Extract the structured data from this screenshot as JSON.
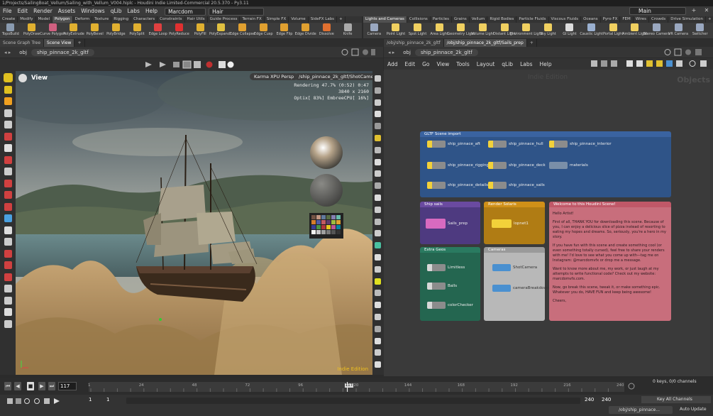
{
  "titlebar": {
    "text": "1/Projects/SailingBoat_Vellum/Sailing_with_Vellum_V004.hiplc - Houdini Indie Limited-Commercial 20.5.370 - Py3.11"
  },
  "menu": [
    "File",
    "Edit",
    "Render",
    "Assets",
    "Windows",
    "qLib",
    "Labs",
    "Help"
  ],
  "desktop": {
    "left_select": "Marcdom",
    "right_select": "Hair",
    "main_select": "Main"
  },
  "shelf_tabs_left": [
    "Create",
    "Modify",
    "Model",
    "Polygon",
    "Deform",
    "Texture",
    "Rigging",
    "Characters",
    "Constraints",
    "Hair Utils",
    "Guide Process",
    "Terrain FX",
    "Simple FX",
    "Volume",
    "SideFX Labs"
  ],
  "shelf_tabs_left_active": "Polygon",
  "shelf_tabs_right": [
    "Lights and Cameras",
    "Collisions",
    "Particles",
    "Grains",
    "Vellum",
    "Rigid Bodies",
    "Particle Fluids",
    "Viscous Fluids",
    "Oceans",
    "Pyro FX",
    "FEM",
    "Wires",
    "Crowds",
    "Drive Simulation"
  ],
  "shelf_tabs_right_active": "Lights and Cameras",
  "shelf_tools_left": [
    {
      "label": "TopoBuild",
      "icon": "topobuild-icon",
      "color": "#8a9bb0"
    },
    {
      "label": "PolyDraw",
      "icon": "polydraw-icon",
      "color": "#e0b030"
    },
    {
      "label": "Curve Polygon",
      "icon": "curve-polygon-icon",
      "color": "#d06080"
    },
    {
      "label": "PolyExtrude",
      "icon": "polyextrude-icon",
      "color": "#e0b030"
    },
    {
      "label": "PolyBevel",
      "icon": "polybevel-icon",
      "color": "#e0b030"
    },
    {
      "label": "PolyBridge",
      "icon": "polybridge-icon",
      "color": "#e0b030"
    },
    {
      "label": "PolySplit",
      "icon": "polysplit-icon",
      "color": "#e0b030"
    },
    {
      "label": "Edge Loop",
      "icon": "edge-loop-icon",
      "color": "#e04040"
    },
    {
      "label": "PolyReduce",
      "icon": "polyreduce-icon",
      "color": "#e03030"
    },
    {
      "label": "PolyFill",
      "icon": "polyfill-icon",
      "color": "#e0b030"
    },
    {
      "label": "PolyExpand...",
      "icon": "polyexpand-icon",
      "color": "#e0c040"
    },
    {
      "label": "Edge Collapse",
      "icon": "edge-collapse-icon",
      "color": "#e0a030"
    },
    {
      "label": "Edge Cusp",
      "icon": "edge-cusp-icon",
      "color": "#e0a030"
    },
    {
      "label": "Edge Flip",
      "icon": "edge-flip-icon",
      "color": "#e0a030"
    },
    {
      "label": "Edge Divide",
      "icon": "edge-divide-icon",
      "color": "#e0a030"
    },
    {
      "label": "Dissolve",
      "icon": "dissolve-icon",
      "color": "#e07030"
    },
    {
      "label": "Knife",
      "icon": "knife-icon",
      "color": "#aaaaaa"
    }
  ],
  "shelf_tools_right": [
    {
      "label": "Camera",
      "icon": "camera-icon",
      "color": "#9aa8c0"
    },
    {
      "label": "Point Light",
      "icon": "point-light-icon",
      "color": "#f0d060"
    },
    {
      "label": "Spot Light",
      "icon": "spot-light-icon",
      "color": "#f0d060"
    },
    {
      "label": "Area Light",
      "icon": "area-light-icon",
      "color": "#f0d060"
    },
    {
      "label": "Geometry Light",
      "icon": "geometry-light-icon",
      "color": "#f0d060"
    },
    {
      "label": "Volume Light",
      "icon": "volume-light-icon",
      "color": "#f0d060"
    },
    {
      "label": "Distant Light",
      "icon": "distant-light-icon",
      "color": "#f0d060"
    },
    {
      "label": "Environment Light",
      "icon": "environment-light-icon",
      "color": "#f0d060"
    },
    {
      "label": "Sky Light",
      "icon": "sky-light-icon",
      "color": "#f0d060"
    },
    {
      "label": "GI Light",
      "icon": "gi-light-icon",
      "color": "#dddddd"
    },
    {
      "label": "Caustic Light",
      "icon": "caustic-light-icon",
      "color": "#9ab0d0"
    },
    {
      "label": "Portal Light",
      "icon": "portal-light-icon",
      "color": "#f0d060"
    },
    {
      "label": "Ambient Light",
      "icon": "ambient-light-icon",
      "color": "#f0d060"
    },
    {
      "label": "Stereo Camera",
      "icon": "stereo-camera-icon",
      "color": "#9aa8c0"
    },
    {
      "label": "VR Camera",
      "icon": "vr-camera-icon",
      "color": "#9aa8c0"
    },
    {
      "label": "Switcher",
      "icon": "switcher-icon",
      "color": "#9aa8c0"
    }
  ],
  "left_pane": {
    "tabs": [
      "Scene Graph Tree",
      "Scene View"
    ],
    "active_tab": "Scene View",
    "path": [
      "obj",
      "ship_pinnace_2k_gltf"
    ]
  },
  "right_pane": {
    "tabs": [
      "/obj/ship_pinnace_2k_gltf",
      "/obj/ship_pinnace_2k_gltf/Sails_prep"
    ],
    "active_tab": "/obj/ship_pinnace_2k_gltf/Sails_prep",
    "path": [
      "obj",
      "ship_pinnace_2k_gltf"
    ]
  },
  "viewport": {
    "view_label": "View",
    "renderer": "Karma XPU Persp",
    "camera": "/ship_pinnace_2k_gltf/ShotCamera",
    "render_info": [
      "Rendering  47.7%  (0:52)  0:47",
      "3840 x 2160",
      "Optix[ 83%] EmbreeCPU[ 16%]"
    ],
    "watermark": "Indie Edition"
  },
  "network": {
    "menu": [
      "Add",
      "Edit",
      "Go",
      "View",
      "Tools",
      "Layout",
      "qLib",
      "Labs",
      "Help"
    ],
    "watermark": "Indie Edition",
    "context_label": "Objects",
    "boxes": [
      {
        "title": "GLTF Scene import",
        "color": "#3a63a0",
        "body": "#2f5488",
        "nodes": [
          "ship_pinnace_aft",
          "ship_pinnace_hull",
          "ship_pinnace_interior",
          "ship_pinnace_rigging",
          "ship_pinnace_deck",
          "materials",
          "ship_pinnace_details",
          "ship_pinnace_sails"
        ]
      },
      {
        "title": "Ship sails",
        "color": "#6a4aa0",
        "body": "#4e3a80",
        "nodes": [
          "Sails_prep"
        ]
      },
      {
        "title": "Render Solaris",
        "color": "#d09018",
        "body": "#b07c14",
        "nodes": [
          "lopnet1"
        ]
      },
      {
        "title": "Welcome to this Houdini Scene!",
        "color": "#c05868",
        "body": "#c86e7c"
      },
      {
        "title": "Extra Geos",
        "color": "#2a7a60",
        "body": "#246650",
        "nodes": [
          "Limitless",
          "Balls",
          "colorChecker"
        ]
      },
      {
        "title": "Cameras",
        "color": "#9a9a9a",
        "body": "#b8b8b8",
        "nodes": [
          "ShotCamera",
          "cameraBreakdown"
        ]
      }
    ],
    "welcome_text": [
      "Hello Artist!",
      "First of all, THANK YOU for downloading this scene. Because of you, I can enjoy a delicious slice of pizza instead of resorting to eating my hopes and dreams. So, seriously, you're a hero in my story.",
      "If you have fun with this scene and create something cool (or even something totally cursed), feel free to share your renders with me! I'd love to see what you come up with—tag me on Instagram: @marcdomvfx or drop me a message.",
      "Want to know more about me, my work, or just laugh at my attempts to write functional code? Check out my website: marcdomvfx.com.",
      "Now, go break this scene, tweak it, or make something epic. Whatever you do, HAVE FUN and keep being awesome!",
      "Cheers,"
    ],
    "node_sublabels": {
      "sails_prep": "Sails_prep",
      "camera": "Camera",
      "lopnet": "lopnet1"
    }
  },
  "timeline": {
    "current_frame": "117",
    "ticks": [
      "1",
      "24",
      "48",
      "72",
      "96",
      "117",
      "120",
      "144",
      "168",
      "192",
      "216",
      "240"
    ],
    "start": "1",
    "start2": "1",
    "end": "240",
    "end2": "240",
    "keys_info": "0 keys, 0/0 channels",
    "key_all": "Key All Channels"
  },
  "status": {
    "path": "/obj/ship_pinnace...",
    "update": "Auto Update"
  }
}
